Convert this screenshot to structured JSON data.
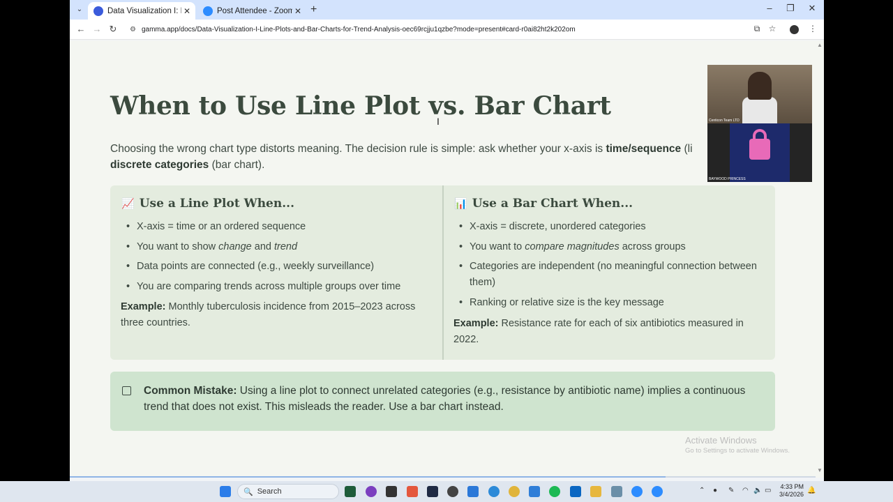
{
  "browser": {
    "tabs": [
      {
        "title": "Data Visualization I: Line Plots a",
        "active": true
      },
      {
        "title": "Post Attendee - Zoom",
        "active": false
      }
    ],
    "url": "gamma.app/docs/Data-Visualization-I-Line-Plots-and-Bar-Charts-for-Trend-Analysis-oec69rcjju1qzbe?mode=present#card-r0ai82ht2k202om"
  },
  "slide": {
    "title": "When to Use Line Plot vs. Bar Chart",
    "intro": {
      "part1": "Choosing the wrong chart type distorts meaning. The decision rule is simple: ask whether your x-axis is ",
      "bold1": "time/sequence",
      "part2": " (li",
      "bold2": "discrete categories",
      "part3": " (bar chart)."
    },
    "line_card": {
      "icon": "📈",
      "heading": "Use a Line Plot When...",
      "items": [
        "X-axis = time or an ordered sequence",
        "Data points are connected (e.g., weekly surveillance)",
        "You are comparing trends across multiple groups over time"
      ],
      "item2": {
        "pre": "You want to show ",
        "em1": "change",
        "mid": " and ",
        "em2": "trend"
      },
      "example_label": "Example:",
      "example_text": " Monthly tuberculosis incidence from 2015–2023 across three countries."
    },
    "bar_card": {
      "icon": "📊",
      "heading": "Use a Bar Chart When...",
      "items": [
        "X-axis = discrete, unordered categories",
        "Categories are independent (no meaningful connection between them)",
        "Ranking or relative size is the key message"
      ],
      "item2": {
        "pre": "You want to ",
        "em": "compare magnitudes",
        "post": " across groups"
      },
      "example_label": "Example:",
      "example_text": " Resistance rate for each of six antibiotics measured in 2022."
    },
    "mistake": {
      "label": "Common Mistake:",
      "text": " Using a line plot to connect unrelated categories (e.g., resistance by antibiotic name) implies a continuous trend that does not exist. This misleads the reader. Use a bar chart instead."
    },
    "progress": 0.79
  },
  "watermark": {
    "line1": "Activate Windows",
    "line2": "Go to Settings to activate Windows."
  },
  "webcam": {
    "name1": "Centicon Team LTD",
    "name2": "BAYWOOD PRINCESS"
  },
  "taskbar": {
    "search_label": "Search",
    "time": "4:33 PM",
    "date": "3/4/2026"
  },
  "colors": {
    "title": "#3b4a3e",
    "card_bg": "#e4ecdf",
    "mistake_bg": "#cfe4cf",
    "page_bg": "#f4f6f1"
  }
}
